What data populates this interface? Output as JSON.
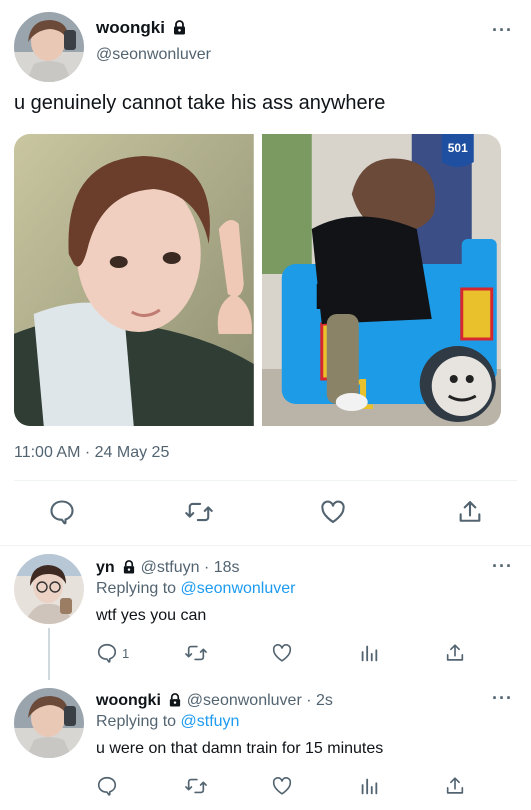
{
  "tweet": {
    "author_name": "woongki",
    "author_handle": "@seonwonluver",
    "text": "u genuinely cannot take his ass anywhere",
    "timestamp": "11:00 AM · 24 May 25",
    "more_label": "···"
  },
  "actions": {
    "reply_icon": "reply-icon",
    "retweet_icon": "retweet-icon",
    "like_icon": "heart-icon",
    "share_icon": "share-icon"
  },
  "replies": [
    {
      "author_name": "yn",
      "author_handle": "@stfuyn",
      "time": "· 18s",
      "replying_prefix": "Replying to ",
      "replying_to": "@seonwonluver",
      "text": "wtf yes you can",
      "reply_count": "1"
    },
    {
      "author_name": "woongki",
      "author_handle": "@seonwonluver",
      "time": "· 2s",
      "replying_prefix": "Replying to ",
      "replying_to": "@stfuyn",
      "text": "u were on that damn train for 15 minutes",
      "reply_count": ""
    }
  ],
  "colors": {
    "link": "#1d9bf0",
    "secondary": "#536471",
    "divider": "#eff3f4",
    "train_blue": "#1e9be6",
    "train_red": "#d6262e"
  }
}
